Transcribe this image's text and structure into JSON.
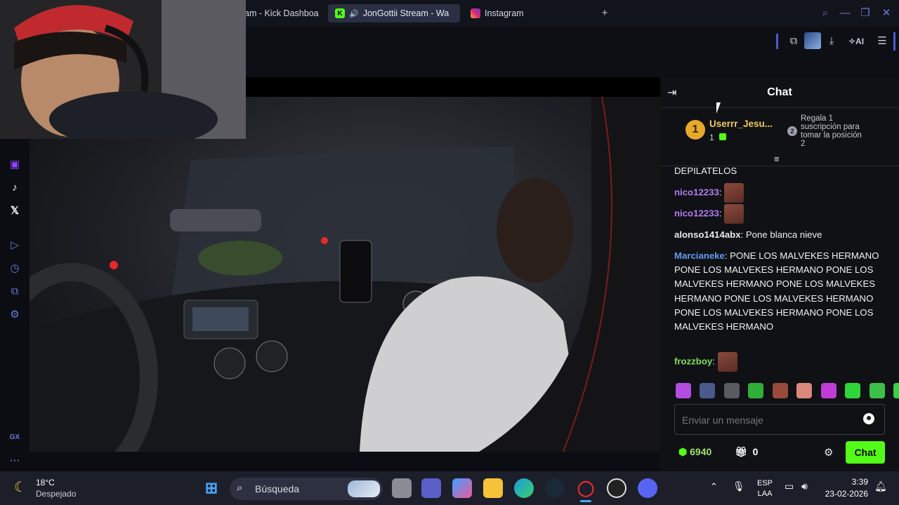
{
  "browser": {
    "tabs": [
      {
        "label": "am - Kick Dashboa",
        "active": false
      },
      {
        "label": "JonGottii Stream - Wa",
        "active": true
      },
      {
        "label": "Instagram",
        "active": false
      }
    ],
    "new_tab": "+",
    "toolbar_ai": "AI"
  },
  "chat": {
    "title": "Chat",
    "top_gifter": {
      "rank": "1",
      "name": "Userrr_Jesu...",
      "count": "1"
    },
    "gift_prompt": {
      "rank": "2",
      "text_line1": "Regala 1",
      "text_line2": "suscripción para",
      "text_line3": "tomar la posición",
      "text_line4": "2"
    },
    "messages": [
      {
        "text": "DEPILATELOS"
      },
      {
        "user": "nico12233",
        "color": "#b57cf3",
        "text": ""
      },
      {
        "user": "nico12233",
        "color": "#b57cf3",
        "text": ""
      },
      {
        "user": "alonso1414abx",
        "color": "#e8e8ea",
        "text": "Pone blanca nieve"
      },
      {
        "user": "Marcianeke",
        "color": "#5f9cf0",
        "text": "PONE LOS MALVEKES HERMANO PONE LOS MALVEKES HERMANO PONE LOS MALVEKES HERMANO PONE LOS MALVEKES HERMANO PONE LOS MALVEKES HERMANO PONE LOS MALVEKES HERMANO PONE LOS MALVEKES HERMANO"
      },
      {
        "user": "frozzboy",
        "color": "#7fe05a",
        "text": ""
      }
    ],
    "input_placeholder": "Enviar un mensaje",
    "points": "6940",
    "gifts": "0",
    "send_label": "Chat",
    "accent": "#53fc18"
  },
  "taskbar": {
    "weather_temp": "18°C",
    "weather_desc": "Despejado",
    "search_label": "Búsqueda",
    "lang_line1": "ESP",
    "lang_line2": "LAA",
    "time": "3:39",
    "date": "23-02-2026"
  },
  "sidebar_gx": "GX"
}
